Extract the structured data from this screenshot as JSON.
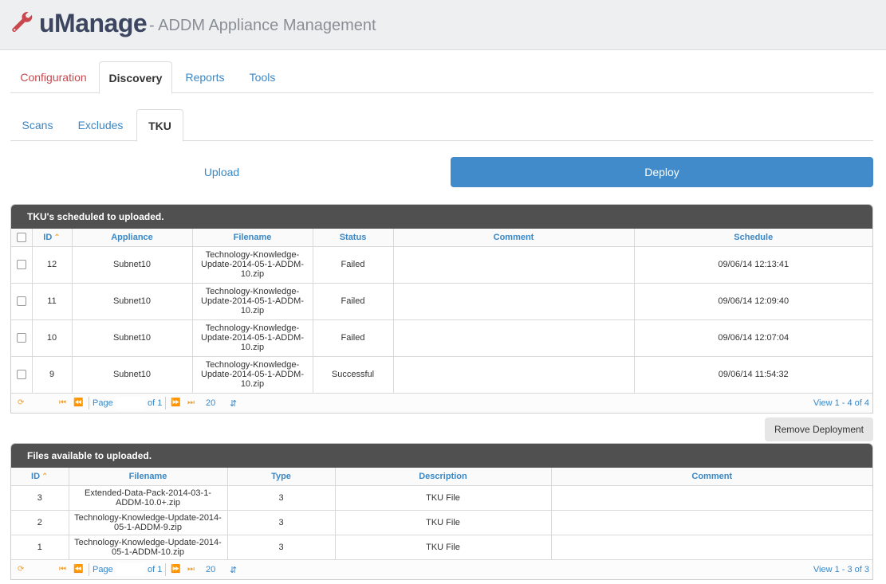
{
  "app": {
    "title": "uManage",
    "subtitle": "- ADDM Appliance Management",
    "logo_icon": "wrench-icon",
    "accent_color": "#c9474d"
  },
  "main_tabs": [
    "Configuration",
    "Discovery",
    "Reports",
    "Tools"
  ],
  "sub_tabs": [
    "Scans",
    "Excludes",
    "TKU"
  ],
  "actions": {
    "upload": "Upload",
    "deploy": "Deploy",
    "remove": "Remove Deployment"
  },
  "scheduled_grid": {
    "caption": "TKU's scheduled to uploaded.",
    "columns": [
      "ID",
      "Appliance",
      "Filename",
      "Status",
      "Comment",
      "Schedule"
    ],
    "rows": [
      {
        "id": "12",
        "appliance": "Subnet10",
        "filename": "Technology-Knowledge-Update-2014-05-1-ADDM-10.zip",
        "status": "Failed",
        "comment": "",
        "schedule": "09/06/14 12:13:41"
      },
      {
        "id": "11",
        "appliance": "Subnet10",
        "filename": "Technology-Knowledge-Update-2014-05-1-ADDM-10.zip",
        "status": "Failed",
        "comment": "",
        "schedule": "09/06/14 12:09:40"
      },
      {
        "id": "10",
        "appliance": "Subnet10",
        "filename": "Technology-Knowledge-Update-2014-05-1-ADDM-10.zip",
        "status": "Failed",
        "comment": "",
        "schedule": "09/06/14 12:07:04"
      },
      {
        "id": "9",
        "appliance": "Subnet10",
        "filename": "Technology-Knowledge-Update-2014-05-1-ADDM-10.zip",
        "status": "Successful",
        "comment": "",
        "schedule": "09/06/14 11:54:32"
      }
    ],
    "pager": {
      "page_label": "Page",
      "of_label": "of 1",
      "page_size": "20",
      "view_text": "View 1 - 4 of 4"
    }
  },
  "files_grid": {
    "caption": "Files available to uploaded.",
    "columns": [
      "ID",
      "Filename",
      "Type",
      "Description",
      "Comment"
    ],
    "rows": [
      {
        "id": "3",
        "filename": "Extended-Data-Pack-2014-03-1-ADDM-10.0+.zip",
        "type": "3",
        "description": "TKU File",
        "comment": ""
      },
      {
        "id": "2",
        "filename": "Technology-Knowledge-Update-2014-05-1-ADDM-9.zip",
        "type": "3",
        "description": "TKU File",
        "comment": ""
      },
      {
        "id": "1",
        "filename": "Technology-Knowledge-Update-2014-05-1-ADDM-10.zip",
        "type": "3",
        "description": "TKU File",
        "comment": ""
      }
    ],
    "pager": {
      "page_label": "Page",
      "of_label": "of 1",
      "page_size": "20",
      "view_text": "View 1 - 3 of 3"
    }
  }
}
